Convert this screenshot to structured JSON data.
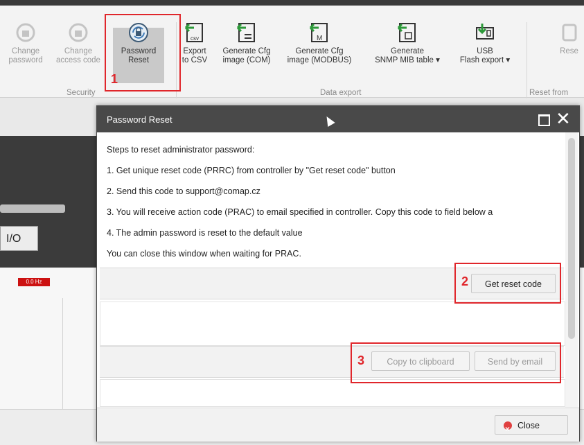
{
  "ribbon": {
    "buttons": [
      {
        "label1": "Change",
        "label2": "password",
        "icon": "lock-icon"
      },
      {
        "label1": "Change",
        "label2": "access code",
        "icon": "lock-icon"
      },
      {
        "label1": "Password",
        "label2": "Reset",
        "icon": "reset-lock-icon"
      },
      {
        "label1": "Export",
        "label2": "to CSV",
        "icon": "csv-icon"
      },
      {
        "label1": "Generate Cfg",
        "label2": "image (COM)",
        "icon": "cfg-com-icon"
      },
      {
        "label1": "Generate Cfg",
        "label2": "image (MODBUS)",
        "icon": "cfg-modbus-icon"
      },
      {
        "label1": "Generate",
        "label2": "SNMP MIB table ▾",
        "icon": "snmp-icon"
      },
      {
        "label1": "USB",
        "label2": "Flash export ▾",
        "icon": "usb-icon"
      },
      {
        "label1": "Rese",
        "label2": "",
        "icon": "reset-icon"
      }
    ],
    "groups": {
      "security": "Security",
      "data_export": "Data export",
      "reset_from": "Reset from"
    }
  },
  "background": {
    "io_label": "I/O",
    "red_badge": "0.0 Hz"
  },
  "dialog": {
    "title": "Password Reset",
    "steps": [
      "Steps to reset administrator password:",
      "1. Get unique reset code (PRRC) from controller by \"Get reset code\" button",
      "2. Send this code to support@comap.cz",
      "3. You will receive action code (PRAC) to email specified in controller. Copy this code to field below a",
      "4. The admin password is reset to the default value",
      "You can close this window when waiting for PRAC."
    ],
    "get_reset_code": "Get reset code",
    "copy_to_clipboard": "Copy to clipboard",
    "send_by_email": "Send by email",
    "close": "Close"
  },
  "annotations": {
    "n1": "1",
    "n2": "2",
    "n3": "3",
    "color": "#e0262b"
  }
}
